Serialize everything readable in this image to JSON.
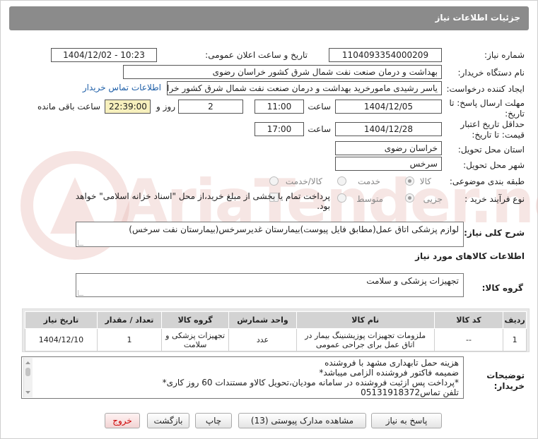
{
  "header": {
    "title": "جزئیات اطلاعات نیاز"
  },
  "need_number": {
    "label": "شماره نیاز:",
    "value": "1104093354000209"
  },
  "announce": {
    "label": "تاریخ و ساعت اعلان عمومی:",
    "value": "1404/12/02 - 10:23"
  },
  "buyer_org": {
    "label": "نام دستگاه خریدار:",
    "value": "بهداشت و درمان صنعت نفت شمال شرق کشور   خراسان رضوی"
  },
  "requester": {
    "label": "ایجاد کننده درخواست:",
    "value": "یاسر رشیدی مامورخرید بهداشت و درمان صنعت نفت شمال شرق کشور   خراسا",
    "contact_link": "اطلاعات تماس خریدار"
  },
  "reply_deadline": {
    "label_line1": "مهلت ارسال پاسخ: تا",
    "label_line2": "تاریخ:",
    "date": "1404/12/05",
    "time_label": "ساعت",
    "time": "11:00",
    "days": "2",
    "days_label": "روز و",
    "remaining": "22:39:00",
    "remaining_label": "ساعت باقی مانده"
  },
  "price_validity": {
    "label_line1": "حداقل تاریخ اعتبار",
    "label_line2": "قیمت: تا تاریخ:",
    "date": "1404/12/28",
    "time_label": "ساعت",
    "time": "17:00"
  },
  "delivery_province": {
    "label": "استان محل تحویل:",
    "value": "خراسان رضوی"
  },
  "delivery_city": {
    "label": "شهر محل تحویل:",
    "value": "سرخس"
  },
  "category": {
    "label": "طبقه بندی موضوعی:",
    "options": [
      "کالا",
      "خدمت",
      "کالا/خدمت"
    ],
    "selected": "کالا"
  },
  "process": {
    "label": "نوع فرآیند خرید :",
    "options": [
      "جزیی",
      "متوسط"
    ],
    "selected": "جزیی",
    "treasury_text": "پرداخت تمام یا بخشی از مبلغ خرید،از محل \"اسناد خزانه اسلامی\" خواهد بود."
  },
  "description": {
    "label": "شرح کلی نیاز:",
    "value": "لوازم پزشکی اتاق عمل(مطابق فایل پیوست)بیمارستان غدیرسرخس(بیمارستان نفت سرخس)"
  },
  "goods_info": {
    "title": "اطلاعات کالاهای مورد نیاز"
  },
  "goods_group": {
    "label": "گروه کالا:",
    "value": "تجهیزات پزشکی و سلامت"
  },
  "items_table": {
    "headers": [
      "ردیف",
      "کد کالا",
      "نام کالا",
      "واحد شمارش",
      "گروه کالا",
      "تعداد / مقدار",
      "تاریخ نیاز"
    ],
    "rows": [
      [
        "1",
        "--",
        "ملزومات تجهیزات پوزیشنینگ بیمار در اتاق عمل برای جراحی عمومی",
        "عدد",
        "تجهیزات پزشکی و سلامت",
        "1",
        "1404/12/10"
      ]
    ]
  },
  "buyer_notes": {
    "label_line1": "توضیحات",
    "label_line2": "خریدار:",
    "lines": [
      "هزینه حمل تابهداری مشهد با فروشنده",
      "ضمیمه فاکتور فروشنده الزامی میباشد*",
      "*پرداخت پس ازثبت فروشنده در سامانه مودیان،تحویل کالاو مستندات 60 روز کاری*",
      "تلفن تماس05131918372"
    ]
  },
  "buttons": {
    "reply": "پاسخ به نیاز",
    "attachments": "مشاهده مدارک پیوستی (13)",
    "print": "چاپ",
    "back": "بازگشت",
    "exit": "خروج"
  },
  "watermark": {
    "text": "AriaTender.neT"
  },
  "colors": {
    "header_bg": "#8b8b8b",
    "link": "#1e5fa8",
    "remaining_bg": "#f7f0bd",
    "exit_text": "#cc0000"
  }
}
